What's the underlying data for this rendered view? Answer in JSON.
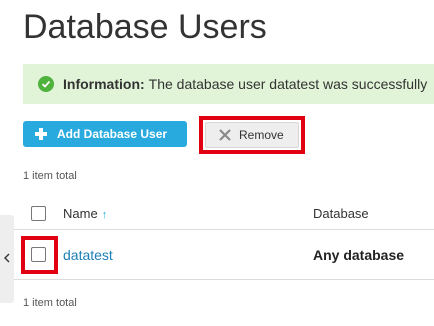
{
  "page": {
    "title": "Database Users"
  },
  "message": {
    "label": "Information:",
    "text": "The database user datatest was successfully"
  },
  "toolbar": {
    "add_label": "Add Database User",
    "remove_label": "Remove"
  },
  "list": {
    "total_top": "1 item total",
    "total_bottom": "1 item total",
    "columns": {
      "name": "Name",
      "database": "Database"
    },
    "rows": [
      {
        "name": "datatest",
        "database": "Any database"
      }
    ]
  },
  "icons": {
    "message": "check-circle-icon",
    "add": "plus-icon",
    "remove": "x-icon",
    "sort": "sort-up-arrow-icon",
    "side": "chevron-left-icon"
  },
  "colors": {
    "accent": "#28aade",
    "success_bg": "#e1f4d7",
    "success_icon": "#4fb23c",
    "link": "#1c7fb6",
    "highlight": "#e00012"
  }
}
